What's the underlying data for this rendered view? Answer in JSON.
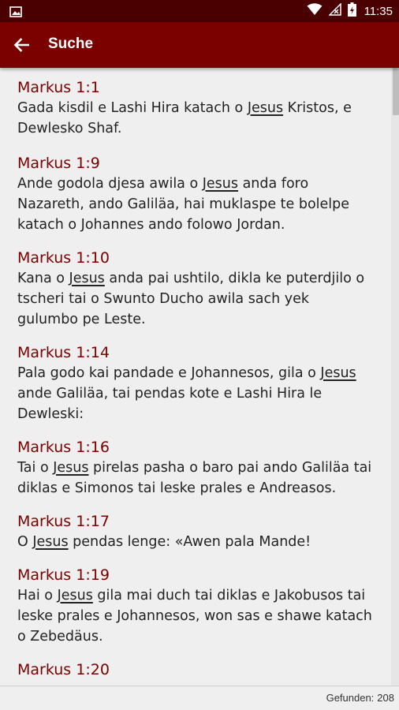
{
  "status_bar": {
    "time": "11:35",
    "icons": [
      "image-icon",
      "wifi-icon",
      "signal-off-icon",
      "battery-charging-icon"
    ]
  },
  "app_bar": {
    "title": "Suche",
    "background": "#7b0000"
  },
  "results": [
    {
      "ref": "Markus 1:1",
      "before": "Gada kisdil e Lashi Hira katach o ",
      "match": "Jesus",
      "after": " Kristos, e Dewlesko Shaf."
    },
    {
      "ref": "Markus 1:9",
      "before": "Ande godola djesa awila o ",
      "match": "Jesus",
      "after": " anda foro Nazareth, ando Galiläa, hai muklaspe te bolelpe katach o Johannes ando folowo Jordan."
    },
    {
      "ref": "Markus 1:10",
      "before": "Kana o ",
      "match": "Jesus",
      "after": " anda pai ushtilo, dikla ke puterdjilo o tscheri tai o Swunto Ducho awila sach yek gulumbo pe Leste."
    },
    {
      "ref": "Markus 1:14",
      "before": "Pala godo kai pandade e Johannesos, gila o ",
      "match": "Jesus",
      "after": " ande Galiläa, tai pendas kote e Lashi Hira le Dewleski:"
    },
    {
      "ref": "Markus 1:16",
      "before": "Tai o ",
      "match": "Jesus",
      "after": " pirelas pasha o baro pai ando Galiläa tai diklas e Simonos tai leske prales e Andreasos."
    },
    {
      "ref": "Markus 1:17",
      "before": "O ",
      "match": "Jesus",
      "after": " pendas lenge: «Awen pala Mande!"
    },
    {
      "ref": "Markus 1:19",
      "before": "Hai o ",
      "match": "Jesus",
      "after": " gila mai duch tai diklas e Jakobusos tai leske prales e Johannesos, won sas e shawe katach o Zebedäus."
    },
    {
      "ref": "Markus 1:20",
      "before": "",
      "match": "",
      "after": ""
    }
  ],
  "footer": {
    "label": "Gefunden:",
    "count": "208"
  }
}
